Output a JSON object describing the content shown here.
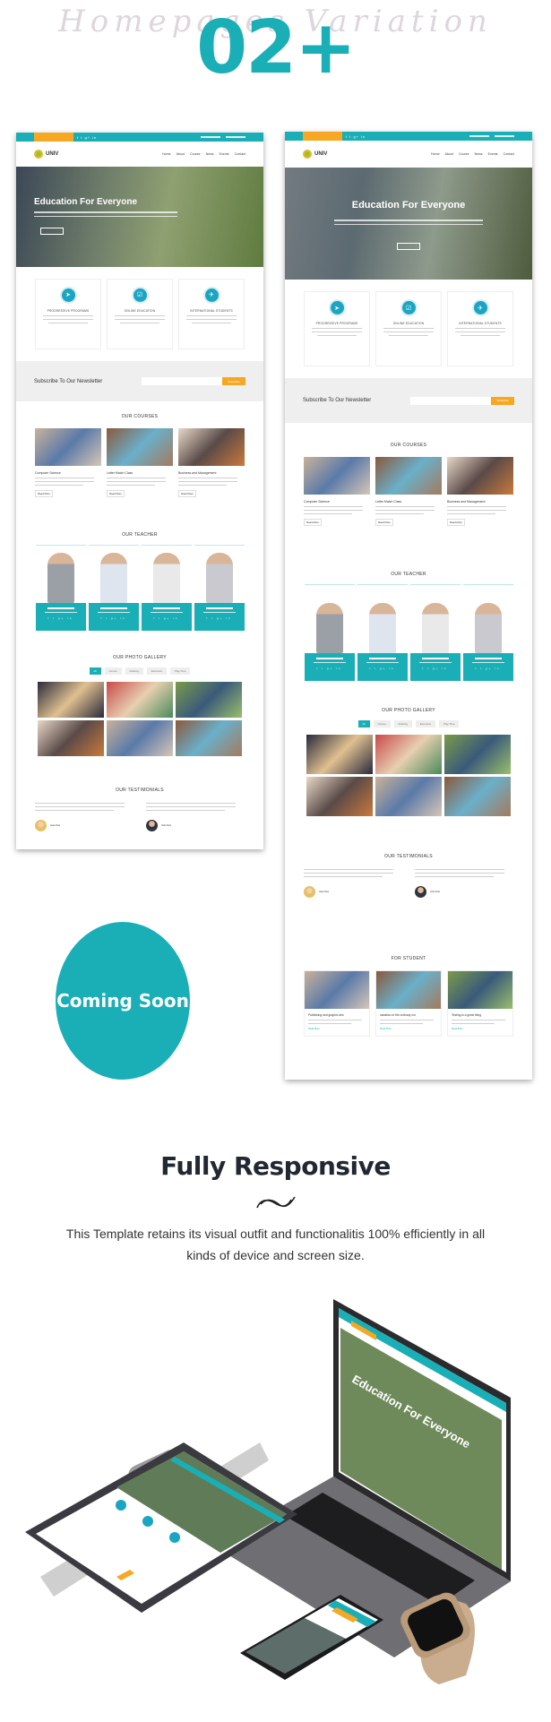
{
  "header": {
    "script_title": "Homepages Variation",
    "count": "02+"
  },
  "colors": {
    "accent": "#1aafb6",
    "orange": "#f7a823",
    "dark": "#222831"
  },
  "site": {
    "logo": "UNIV",
    "menu": [
      "Home",
      "About",
      "Course",
      "News",
      "Events",
      "Contact"
    ],
    "hero_title": "Education For Everyone",
    "features": [
      {
        "icon": "paper-plane-icon",
        "glyph": "➤",
        "title": "PROGRESSIVE PROGRAMS"
      },
      {
        "icon": "monitor-check-icon",
        "glyph": "☑",
        "title": "ONLINE EDUCATION"
      },
      {
        "icon": "airplane-icon",
        "glyph": "✈",
        "title": "INTERNATIONAL STUDENTS"
      }
    ],
    "newsletter": {
      "title": "Subscribe To Our Newsletter",
      "button": "Subscribe"
    },
    "courses": {
      "title": "OUR COURSES",
      "items": [
        "Computer Science",
        "Letter Match Class",
        "Business and Management"
      ],
      "button": "Read More"
    },
    "teacher": {
      "title": "OUR TEACHER"
    },
    "gallery": {
      "title": "OUR PHOTO GALLERY",
      "filters": [
        "All",
        "Course",
        "Drawing",
        "Excursion",
        "Play Time"
      ]
    },
    "testimonials": {
      "title": "OUR TESTIMONIALS",
      "authors": [
        "Jane Doe",
        "John Doe"
      ]
    },
    "for_student": {
      "title": "FOR STUDENT",
      "posts": [
        "Publishing and graphic des",
        "variation of the ordinary cor",
        "Testing is a great thing"
      ],
      "more": "Read More"
    }
  },
  "coming_soon": "Coming Soon",
  "responsive": {
    "title": "Fully Responsive",
    "description": "This Template retains its visual outfit and functionalitis 100% efficiently in all kinds of device and screen size."
  }
}
